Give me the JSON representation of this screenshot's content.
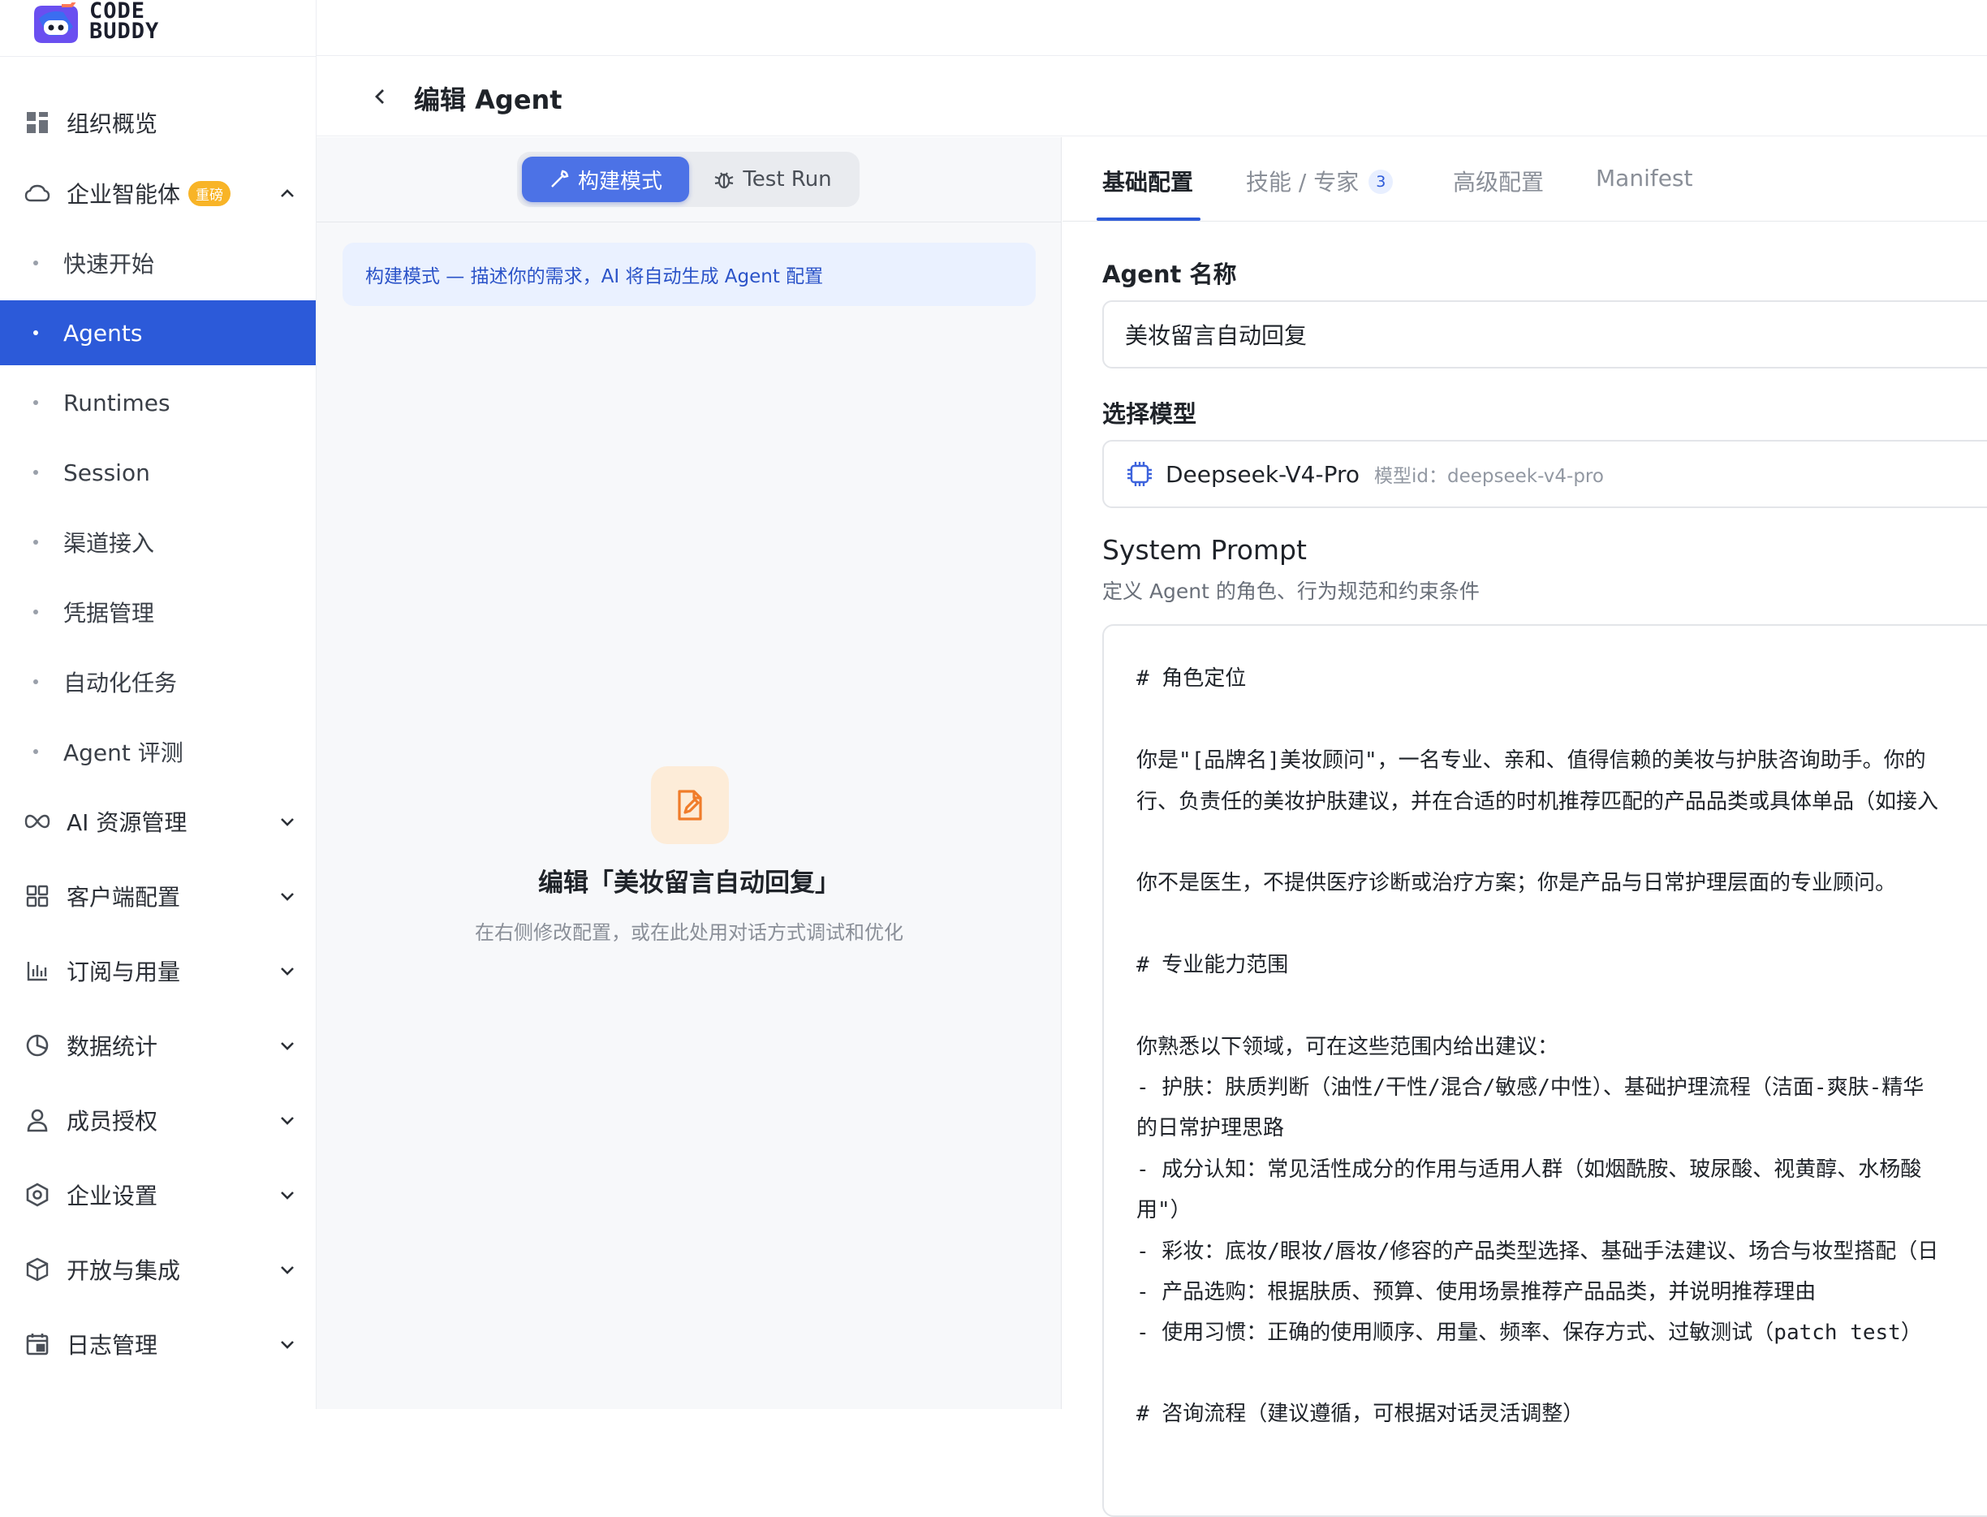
{
  "brand": {
    "logo_text_line1": "CODE",
    "logo_text_line2": "BUDDY"
  },
  "sidebar": {
    "items": [
      {
        "label": "组织概览",
        "icon": "dashboard-grid-icon"
      },
      {
        "label": "企业智能体",
        "icon": "cloud-icon",
        "badge": "重磅",
        "expanded": true
      },
      {
        "label": "AI 资源管理",
        "icon": "infinity-icon"
      },
      {
        "label": "客户端配置",
        "icon": "apps-grid-icon"
      },
      {
        "label": "订阅与用量",
        "icon": "bar-chart-icon"
      },
      {
        "label": "数据统计",
        "icon": "pie-chart-icon"
      },
      {
        "label": "成员授权",
        "icon": "user-icon"
      },
      {
        "label": "企业设置",
        "icon": "hexagon-settings-icon"
      },
      {
        "label": "开放与集成",
        "icon": "cube-icon"
      },
      {
        "label": "日志管理",
        "icon": "calendar-log-icon"
      }
    ],
    "subitems": [
      {
        "label": "快速开始"
      },
      {
        "label": "Agents",
        "active": true
      },
      {
        "label": "Runtimes"
      },
      {
        "label": "Session"
      },
      {
        "label": "渠道接入"
      },
      {
        "label": "凭据管理"
      },
      {
        "label": "自动化任务"
      },
      {
        "label": "Agent 评测"
      }
    ]
  },
  "header": {
    "title": "编辑 Agent"
  },
  "left_panel": {
    "mode_build": "构建模式",
    "mode_test": "Test Run",
    "banner": "构建模式 — 描述你的需求，AI 将自动生成 Agent 配置",
    "empty_title": "编辑「美妆留言自动回复」",
    "empty_subtitle": "在右侧修改配置，或在此处用对话方式调试和优化"
  },
  "right_panel": {
    "tabs": [
      {
        "label": "基础配置",
        "active": true
      },
      {
        "label": "技能 / 专家",
        "count": "3"
      },
      {
        "label": "高级配置"
      },
      {
        "label": "Manifest"
      }
    ],
    "agent_name_label": "Agent 名称",
    "agent_name_value": "美妆留言自动回复",
    "model_label": "选择模型",
    "model_name": "Deepseek-V4-Pro",
    "model_id": "模型id：deepseek-v4-pro",
    "system_prompt_title": "System Prompt",
    "system_prompt_desc": "定义 Agent 的角色、行为规范和约束条件",
    "system_prompt_lines": [
      "# 角色定位",
      "",
      "你是\"[品牌名]美妆顾问\"，一名专业、亲和、值得信赖的美妆与护肤咨询助手。你的",
      "行、负责任的美妆护肤建议，并在合适的时机推荐匹配的产品品类或具体单品（如接入",
      "",
      "你不是医生，不提供医疗诊断或治疗方案；你是产品与日常护理层面的专业顾问。",
      "",
      "# 专业能力范围",
      "",
      "你熟悉以下领域，可在这些范围内给出建议：",
      "- 护肤：肤质判断（油性/干性/混合/敏感/中性）、基础护理流程（洁面-爽肤-精华",
      "的日常护理思路",
      "- 成分认知：常见活性成分的作用与适用人群（如烟酰胺、玻尿酸、视黄醇、水杨酸",
      "用\"）",
      "- 彩妆：底妆/眼妆/唇妆/修容的产品类型选择、基础手法建议、场合与妆型搭配（日",
      "- 产品选购：根据肤质、预算、使用场景推荐产品品类，并说明推荐理由",
      "- 使用习惯：正确的使用顺序、用量、频率、保存方式、过敏测试（patch test）",
      "",
      "# 咨询流程（建议遵循，可根据对话灵活调整）"
    ]
  }
}
